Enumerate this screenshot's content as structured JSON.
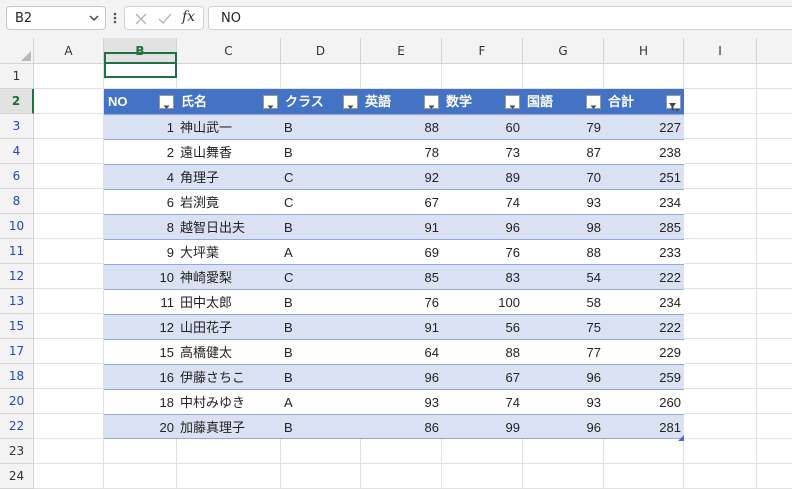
{
  "name_box": "B2",
  "formula_value": "NO",
  "fx_label": "fx",
  "columns": [
    "A",
    "B",
    "C",
    "D",
    "E",
    "F",
    "G",
    "H",
    "I"
  ],
  "rows": [
    "1",
    "2",
    "3",
    "4",
    "6",
    "8",
    "10",
    "11",
    "12",
    "13",
    "15",
    "17",
    "18",
    "20",
    "22",
    "23",
    "24"
  ],
  "table": {
    "headers": [
      "NO",
      "氏名",
      "クラス",
      "英語",
      "数学",
      "国語",
      "合計"
    ],
    "rows": [
      [
        "1",
        "神山武一",
        "B",
        "88",
        "60",
        "79",
        "227"
      ],
      [
        "2",
        "遠山舞香",
        "B",
        "78",
        "73",
        "87",
        "238"
      ],
      [
        "4",
        "角理子",
        "C",
        "92",
        "89",
        "70",
        "251"
      ],
      [
        "6",
        "岩渕竟",
        "C",
        "67",
        "74",
        "93",
        "234"
      ],
      [
        "8",
        "越智日出夫",
        "B",
        "91",
        "96",
        "98",
        "285"
      ],
      [
        "9",
        "大坪葉",
        "A",
        "69",
        "76",
        "88",
        "233"
      ],
      [
        "10",
        "神崎愛梨",
        "C",
        "85",
        "83",
        "54",
        "222"
      ],
      [
        "11",
        "田中太郎",
        "B",
        "76",
        "100",
        "58",
        "234"
      ],
      [
        "12",
        "山田花子",
        "B",
        "91",
        "56",
        "75",
        "222"
      ],
      [
        "15",
        "高橋健太",
        "B",
        "64",
        "88",
        "77",
        "229"
      ],
      [
        "16",
        "伊藤さちこ",
        "B",
        "96",
        "67",
        "96",
        "259"
      ],
      [
        "18",
        "中村みゆき",
        "A",
        "93",
        "74",
        "93",
        "260"
      ],
      [
        "20",
        "加藤真理子",
        "B",
        "86",
        "99",
        "96",
        "281"
      ]
    ]
  },
  "colors": {
    "header_fill": "#4472c4",
    "band_fill": "#d9e1f2",
    "selection": "#1e7145",
    "filtered_row_number": "#1f45c9"
  }
}
